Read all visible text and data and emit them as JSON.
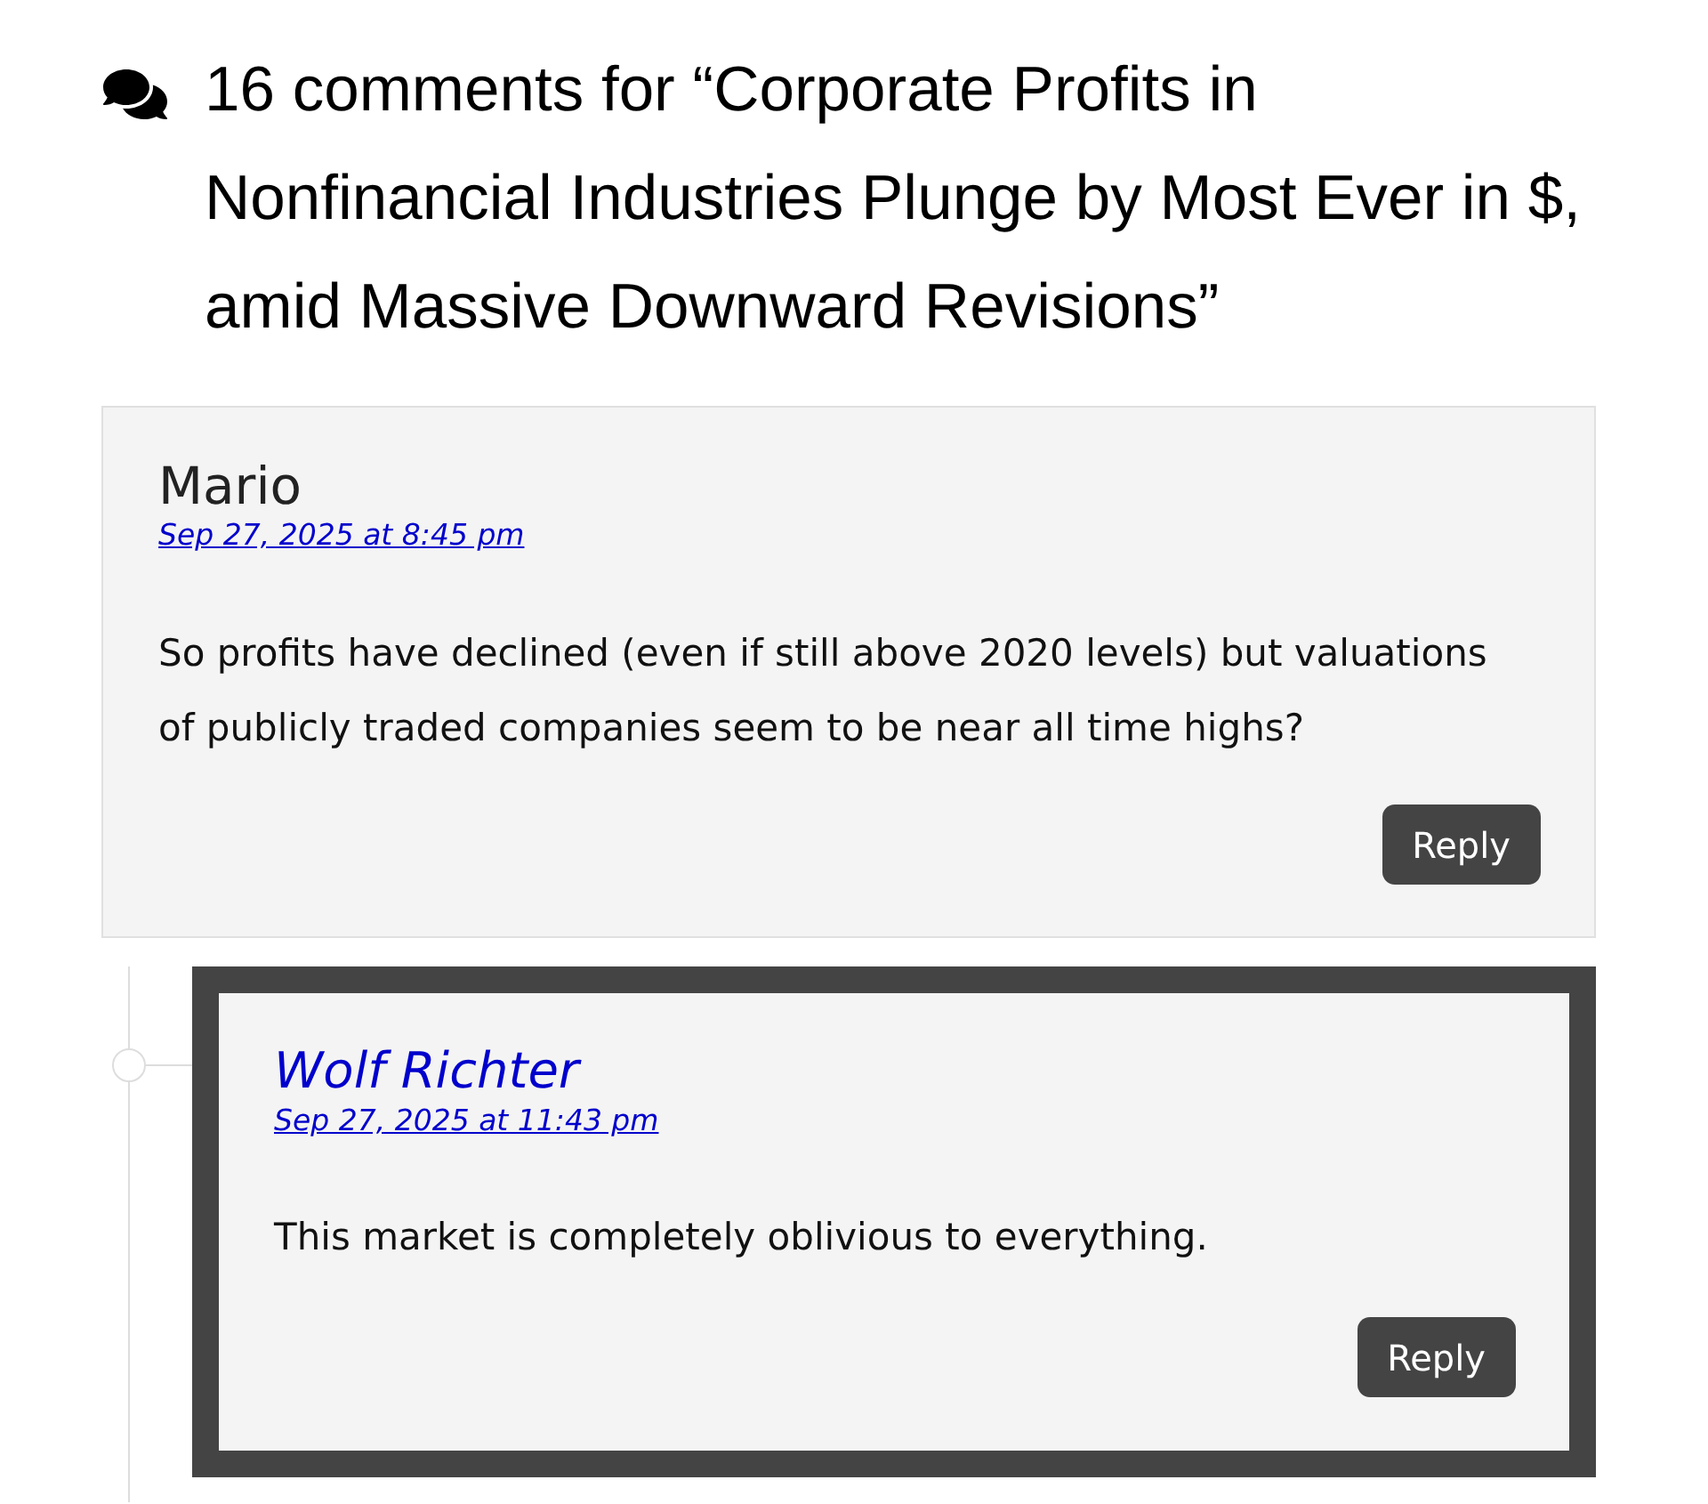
{
  "heading": {
    "text": "16 comments for “Corporate Profits in Nonfinancial Industries Plunge by Most Ever in $, amid Massive Downward Revisions”"
  },
  "comments": [
    {
      "kind": "reader",
      "author": "Mario",
      "date": "Sep 27, 2025 at 8:45 pm",
      "text": "So profits have declined (even if still above 2020 levels) but valuations of publicly traded companies seem to be near all time highs?",
      "reply_button": "Reply",
      "children": [
        {
          "kind": "author",
          "author": "Wolf Richter",
          "date": "Sep 27, 2025 at 11:43 pm",
          "text": "This market is completely oblivious to everything.",
          "reply_button": "Reply"
        }
      ]
    }
  ]
}
